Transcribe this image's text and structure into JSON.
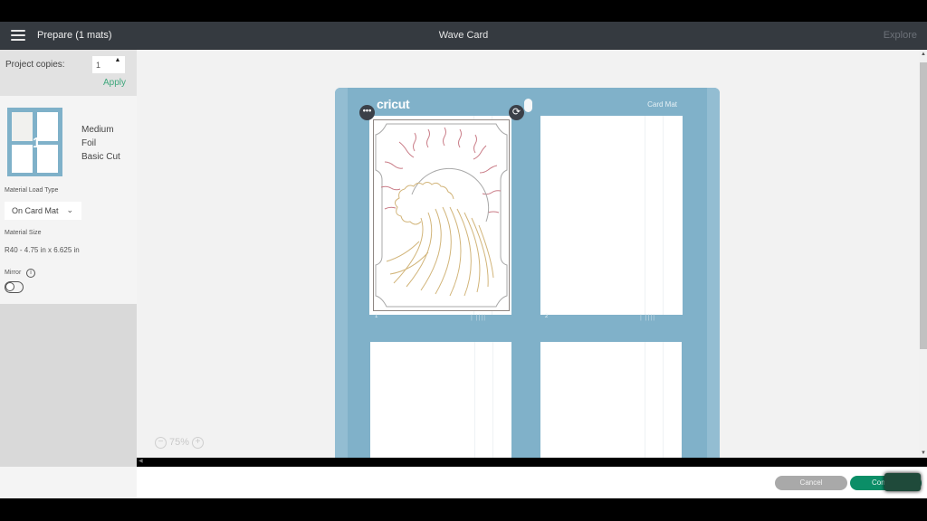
{
  "topbar": {
    "menu_icon": "hamburger-menu-icon",
    "prepare_title": "Prepare (1 mats)",
    "project_title": "Wave Card",
    "explore_label": "Explore"
  },
  "sidebar": {
    "copies_label": "Project copies:",
    "copies_value": "1",
    "stepper_up": "▲",
    "apply_label": "Apply",
    "mat_thumb_number": "1",
    "material": {
      "line1": "Medium",
      "line2": "Foil",
      "line3": "Basic Cut"
    },
    "load_type_label": "Material Load Type",
    "load_type_value": "On Card Mat",
    "load_type_chevron": "⌄",
    "size_label": "Material Size",
    "size_value": "R40 - 4.75 in x 6.625 in",
    "mirror_label": "Mirror",
    "info_glyph": "i",
    "mirror_on": false
  },
  "mat": {
    "logo": "cricut",
    "type_label": "Card Mat",
    "more_glyph": "•••",
    "rotate_glyph": "⟳",
    "slots": [
      {
        "number": "1"
      },
      {
        "number": "2"
      },
      {
        "number": ""
      },
      {
        "number": ""
      }
    ],
    "ticks": "| ||||"
  },
  "zoom": {
    "minus": "−",
    "level": "75%",
    "plus": "+"
  },
  "scroll": {
    "up": "▲",
    "down": "▼",
    "left": "◀"
  },
  "footer": {
    "cancel_label": "Cancel",
    "continue_label": "Continue"
  },
  "colors": {
    "topbar": "#353a40",
    "accent_green": "#0b8e67",
    "apply_green": "#3fa77c",
    "mat_blue": "#80b1c9",
    "sun_rays": "#c97b86",
    "wave_gold": "#d2b57a"
  }
}
